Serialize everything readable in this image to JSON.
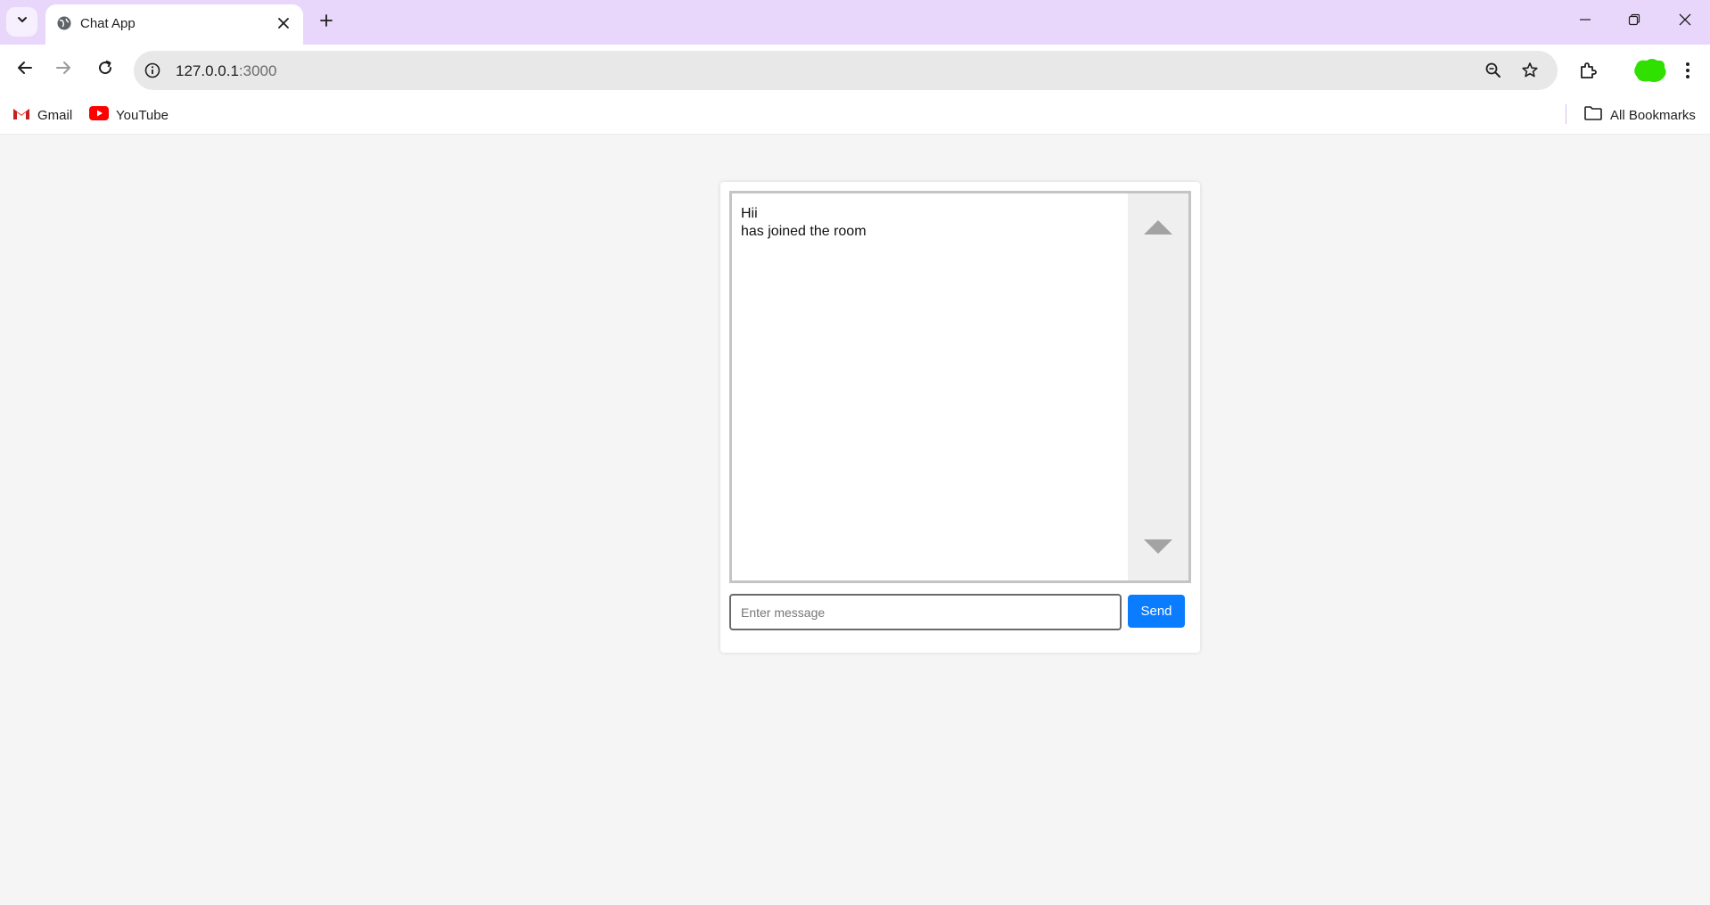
{
  "browser": {
    "tab": {
      "title": "Chat App",
      "favicon": "globe-icon"
    },
    "url": {
      "host": "127.0.0.1",
      "port": ":3000"
    },
    "bookmarks": [
      {
        "label": "Gmail",
        "icon": "gmail-icon"
      },
      {
        "label": "YouTube",
        "icon": "youtube-icon"
      }
    ],
    "all_bookmarks_label": "All Bookmarks"
  },
  "chat": {
    "messages": [
      "Hii",
      "has joined the room"
    ],
    "input": {
      "placeholder": "Enter message",
      "value": ""
    },
    "send_label": "Send"
  },
  "colors": {
    "tabstrip": "#e9d7fb",
    "page_background": "#f5f5f5",
    "send_button": "#0a7cff",
    "profile_avatar": "#2fe000"
  }
}
